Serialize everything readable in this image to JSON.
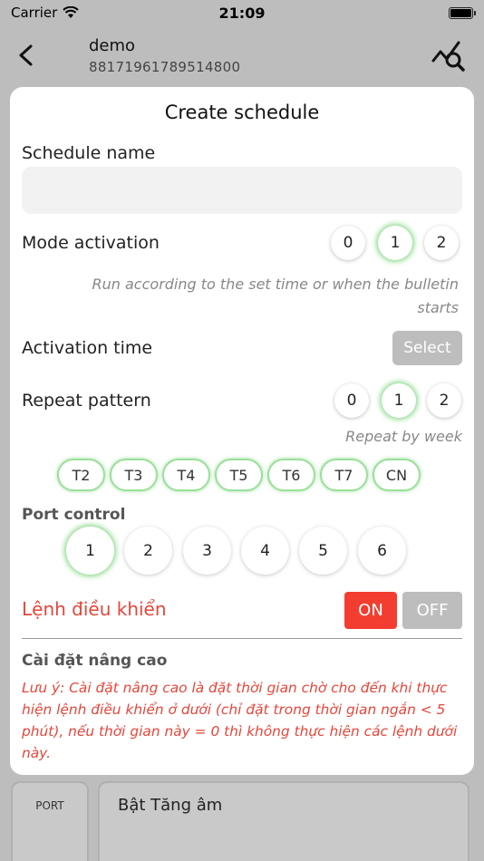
{
  "status": {
    "carrier": "Carrier",
    "time": "21:09"
  },
  "header": {
    "title": "demo",
    "subtitle": "8817196178951480​0"
  },
  "modal": {
    "title": "Create schedule",
    "schedule_name_label": "Schedule name",
    "schedule_name_value": "",
    "mode_label": "Mode activation",
    "mode_options": [
      "0",
      "1",
      "2"
    ],
    "mode_selected": "1",
    "mode_hint_line1": "Run according to the set time or when the bulletin",
    "mode_hint_line2": "starts",
    "activation_time_label": "Activation time",
    "select_label": "Select",
    "repeat_label": "Repeat pattern",
    "repeat_options": [
      "0",
      "1",
      "2"
    ],
    "repeat_selected": "1",
    "repeat_hint": "Repeat by week",
    "days": [
      "T2",
      "T3",
      "T4",
      "T5",
      "T6",
      "T7",
      "CN"
    ],
    "port_control_label": "Port control",
    "ports": [
      "1",
      "2",
      "3",
      "4",
      "5",
      "6"
    ],
    "port_selected": "1",
    "command_label": "Lệnh điều khiển",
    "on_label": "ON",
    "off_label": "OFF",
    "advanced_label": "Cài đặt nâng cao",
    "advanced_note": "Lưu ý: Cài đặt nâng cao là đặt thời gian chờ cho đến khi thực hiện lệnh điều khiển ở dưới (chỉ đặt trong thời gian ngắn < 5 phút), nếu thời gian này = 0 thì không thực hiện các lệnh dưới này."
  },
  "background": {
    "port_label": "PORT",
    "card_title": "Bật Tăng âm"
  },
  "colors": {
    "accent_red": "#f33d30",
    "active_glow": "#66cc66",
    "disabled": "#bdbdbd"
  }
}
